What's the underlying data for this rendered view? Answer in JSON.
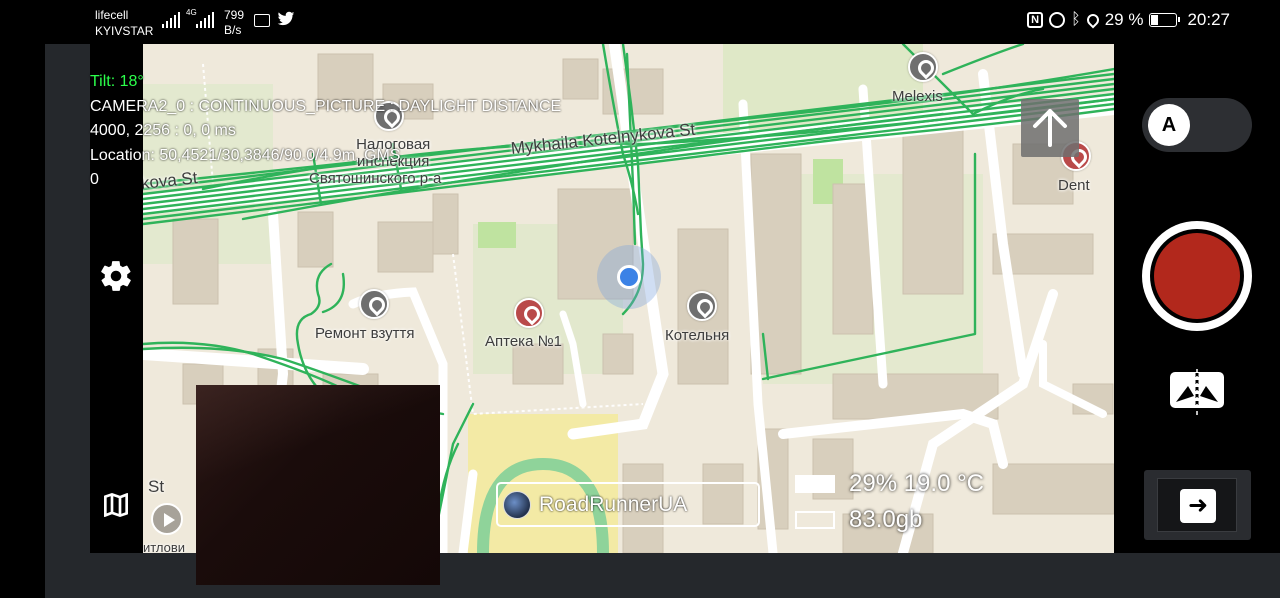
{
  "status_bar": {
    "carrier_1": "lifecell",
    "carrier_2": "KYIVSTAR",
    "net_type": "4G",
    "net_speed_value": "799",
    "net_speed_unit": "B/s",
    "battery_percent": "29 %",
    "battery_level": 0.29,
    "time": "20:27",
    "icons": [
      "signal-icon",
      "signal-4g-icon",
      "news-icon",
      "twitter-icon",
      "nfc-icon",
      "alarm-icon",
      "bluetooth-icon",
      "location-icon",
      "battery-icon"
    ]
  },
  "overlay": {
    "tilt": "Tilt: 18°",
    "camera_line": "CAMERA2_0 : CONTINUOUS_PICTURE : DAYLIGHT DISTANCE",
    "resolution_line": "4000, 2256 : 0, 0 ms",
    "location_line": "Location: 50,4521/30,3846/90.0/4.9m, GMS",
    "counter": "0"
  },
  "map": {
    "streets": {
      "main": "Mykhaila Kotelnykova St",
      "left": "kova St",
      "bottom_left": "St",
      "bottom_left_2": "итлови"
    },
    "places": {
      "tax": [
        "Налоговая",
        "инспекция",
        "Святошинского р-а"
      ],
      "shoe_repair": "Ремонт взуття",
      "pharmacy": "Аптека №1",
      "boiler": "Котельня",
      "melexis": "Melexis",
      "dent": "Dent"
    }
  },
  "user": {
    "name": "RoadRunnerUA"
  },
  "stats": {
    "battery_temp": "29%  19.0 °C",
    "storage": "83.0gb"
  },
  "controls": {
    "mode_toggle_letter": "A",
    "switch_arrow": "➜"
  },
  "colors": {
    "track": "#2fb35a",
    "record": "#b2281c",
    "tilt_text": "#2bff4b",
    "location_dot": "#3b82e6"
  }
}
